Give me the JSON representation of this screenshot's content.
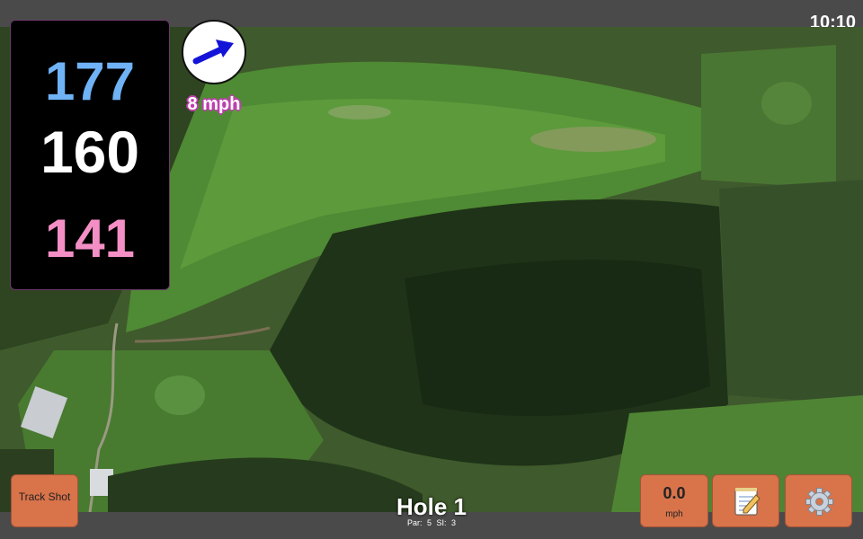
{
  "status_bar": {
    "time": "10:10"
  },
  "distances": {
    "back": "177",
    "middle": "160",
    "front": "141"
  },
  "wind": {
    "speed": "8 mph",
    "direction_icon": "arrow-icon"
  },
  "buttons": {
    "track_shot": "Track Shot",
    "speed_value": "0.0",
    "speed_unit": "mph",
    "notes_icon": "notepad-icon",
    "settings_icon": "gear-icon"
  },
  "hole": {
    "title": "Hole 1",
    "par": "Par: 5",
    "si": "SI: 3"
  },
  "colors": {
    "back_distance": "#6fb2f5",
    "middle_distance": "#ffffff",
    "front_distance": "#f48fc6",
    "button": "#d8734a",
    "wind_outline": "#c03fb0"
  }
}
